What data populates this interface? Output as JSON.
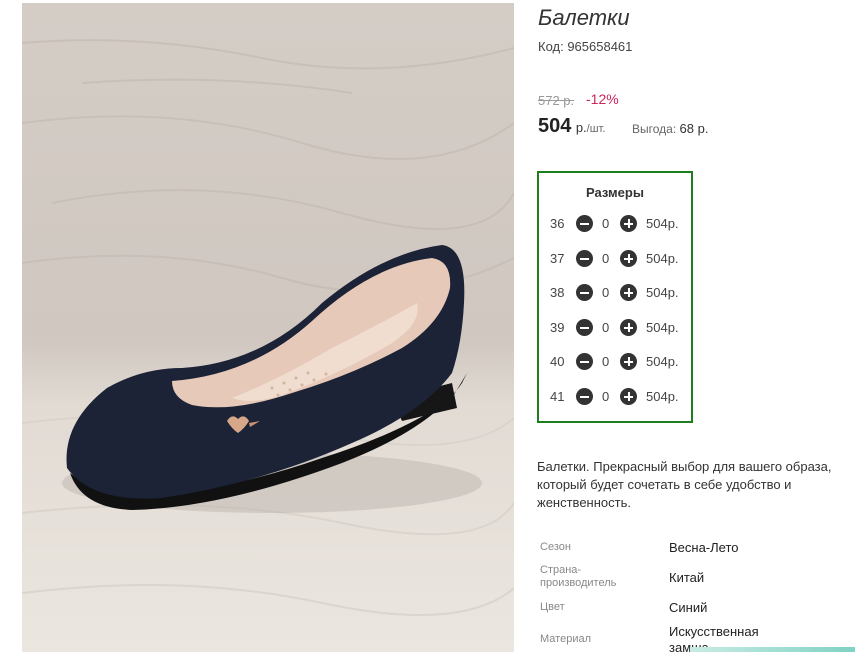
{
  "product": {
    "title": "Балетки",
    "code": "Код: 965658461",
    "old_price": "572 р.",
    "discount": "-12%",
    "price": "504",
    "price_unit": "р.",
    "price_per": "/шт.",
    "benefit_label": "Выгода:",
    "benefit_value": "68 р."
  },
  "sizes": {
    "title": "Размеры",
    "rows": [
      {
        "size": "36",
        "qty": "0",
        "price": "504р."
      },
      {
        "size": "37",
        "qty": "0",
        "price": "504р."
      },
      {
        "size": "38",
        "qty": "0",
        "price": "504р."
      },
      {
        "size": "39",
        "qty": "0",
        "price": "504р."
      },
      {
        "size": "40",
        "qty": "0",
        "price": "504р."
      },
      {
        "size": "41",
        "qty": "0",
        "price": "504р."
      }
    ]
  },
  "description": "Балетки. Прекрасный выбор для вашего образа, который будет сочетать в себе удобство и женственность.",
  "properties": [
    {
      "label": "Сезон",
      "value": "Весна-Лето"
    },
    {
      "label": "Страна-производитель",
      "value": "Китай"
    },
    {
      "label": "Цвет",
      "value": "Синий"
    },
    {
      "label": "Материал",
      "value": "Искусственная замша"
    }
  ],
  "icons": {
    "minus": "minus-circle-icon",
    "plus": "plus-circle-icon"
  },
  "colors": {
    "discount": "#d0245a",
    "sizes_border": "#1e7e1e",
    "shoe": "#1c2336"
  }
}
